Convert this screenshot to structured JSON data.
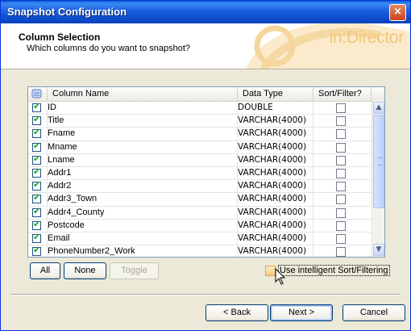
{
  "window": {
    "title": "Snapshot Configuration",
    "close_glyph": "×"
  },
  "header": {
    "title": "Column Selection",
    "subtitle": "Which columns do you want to snapshot?",
    "brand": "in:Director"
  },
  "grid": {
    "headers": [
      "Column Name",
      "Data Type",
      "Sort/Filter?"
    ],
    "rows": [
      {
        "name": "ID",
        "type": "DOUBLE",
        "selected": true,
        "sort": false
      },
      {
        "name": "Title",
        "type": "VARCHAR(4000)",
        "selected": true,
        "sort": false
      },
      {
        "name": "Fname",
        "type": "VARCHAR(4000)",
        "selected": true,
        "sort": false
      },
      {
        "name": "Mname",
        "type": "VARCHAR(4000)",
        "selected": true,
        "sort": false
      },
      {
        "name": "Lname",
        "type": "VARCHAR(4000)",
        "selected": true,
        "sort": false
      },
      {
        "name": "Addr1",
        "type": "VARCHAR(4000)",
        "selected": true,
        "sort": false
      },
      {
        "name": "Addr2",
        "type": "VARCHAR(4000)",
        "selected": true,
        "sort": false
      },
      {
        "name": "Addr3_Town",
        "type": "VARCHAR(4000)",
        "selected": true,
        "sort": false
      },
      {
        "name": "Addr4_County",
        "type": "VARCHAR(4000)",
        "selected": true,
        "sort": false
      },
      {
        "name": "Postcode",
        "type": "VARCHAR(4000)",
        "selected": true,
        "sort": false
      },
      {
        "name": "Email",
        "type": "VARCHAR(4000)",
        "selected": true,
        "sort": false
      },
      {
        "name": "PhoneNumber2_Work",
        "type": "VARCHAR(4000)",
        "selected": true,
        "sort": false
      }
    ]
  },
  "buttons": {
    "all": "All",
    "none": "None",
    "toggle": "Toggle",
    "back": "< Back",
    "next": "Next >",
    "cancel": "Cancel"
  },
  "intelligent": {
    "label": "Use intelligent Sort/Filtering",
    "checked": false
  },
  "colors": {
    "title_blue": "#0a49c9",
    "accent_orange": "#f1c77a",
    "check_green": "#21a121"
  }
}
